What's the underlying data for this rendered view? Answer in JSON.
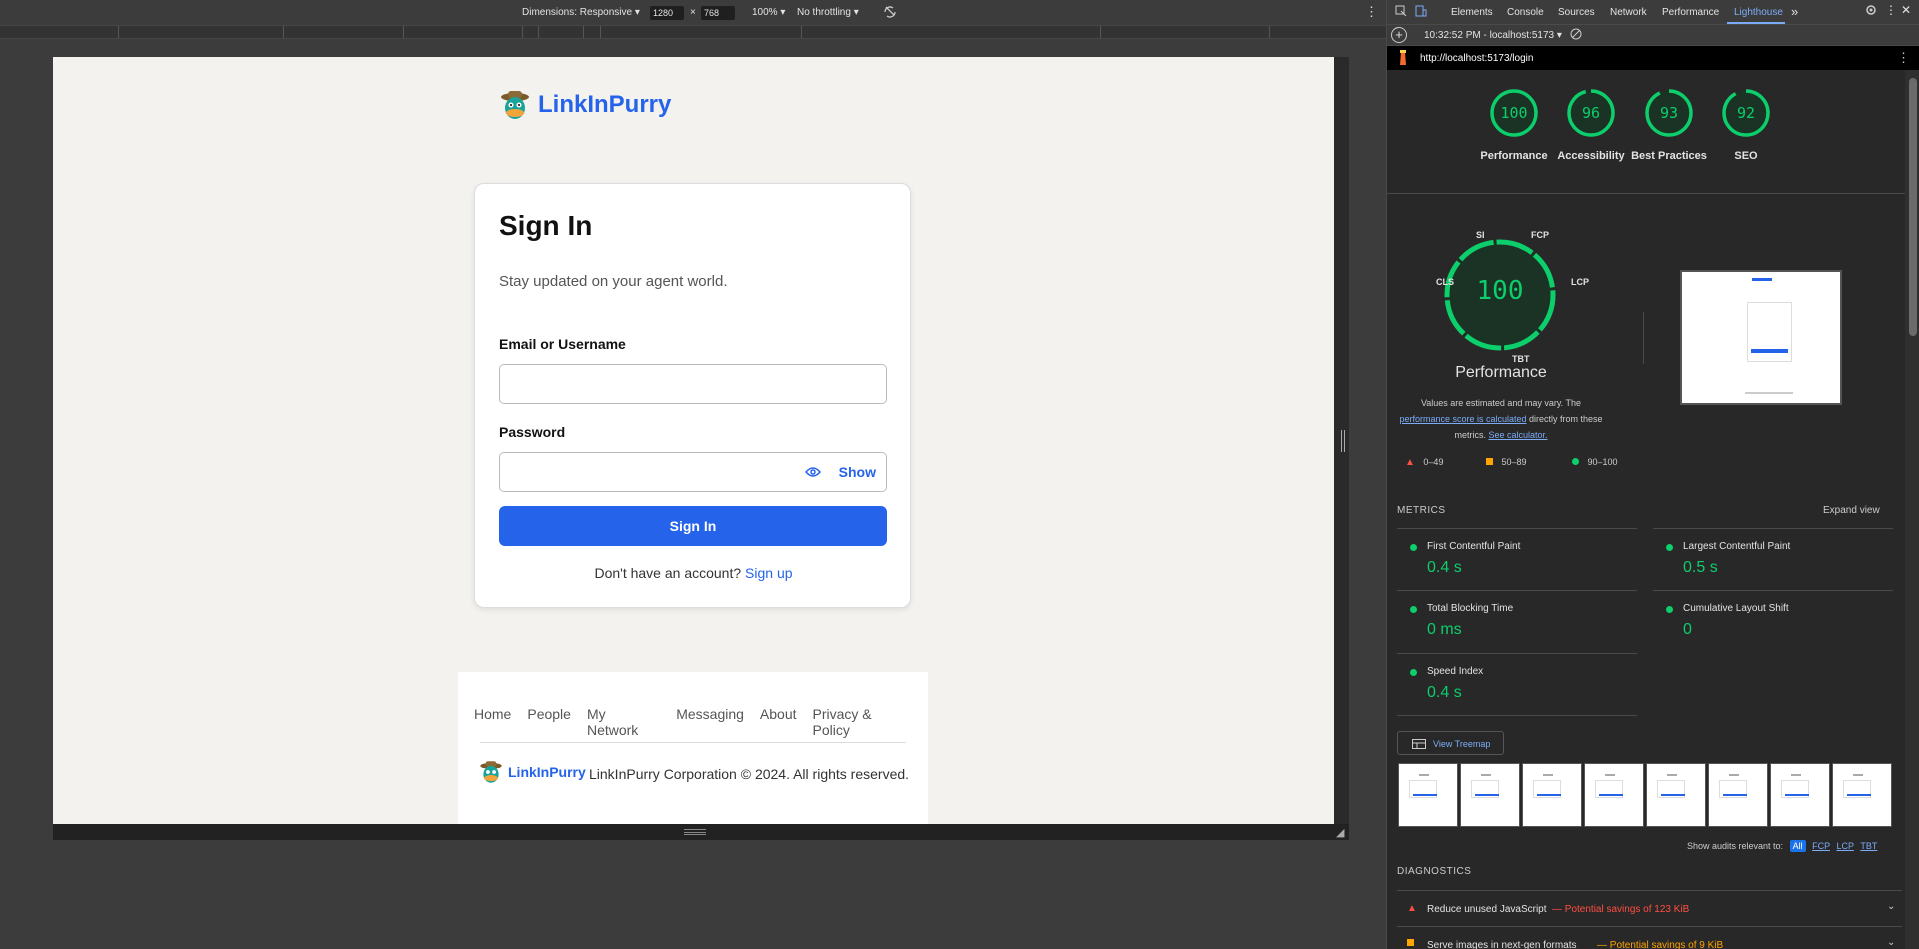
{
  "device_toolbar": {
    "dimensions_label": "Dimensions: Responsive ▾",
    "width": "1280",
    "x": "×",
    "height": "768",
    "zoom": "100% ▾",
    "throttling": "No throttling ▾"
  },
  "page": {
    "brand": "LinkInPurry",
    "title": "Sign In",
    "subtitle": "Stay updated on your agent world.",
    "email_label": "Email or Username",
    "password_label": "Password",
    "show_label": "Show",
    "signin_button": "Sign In",
    "no_account": "Don't have an account?",
    "signup_link": "Sign up",
    "footer_links": [
      "Home",
      "People",
      "My Network",
      "Messaging",
      "About",
      "Privacy & Policy"
    ],
    "copyright": "LinkInPurry Corporation © 2024. All rights reserved."
  },
  "devtools": {
    "tabs": [
      "Elements",
      "Console",
      "Sources",
      "Network",
      "Performance",
      "Lighthouse"
    ],
    "active_tab": "Lighthouse",
    "more": "»",
    "report_time": "10:32:52 PM - localhost:5173 ▾",
    "url": "http://localhost:5173/login",
    "scores": [
      {
        "value": "100",
        "label": "Performance",
        "fraction": 1.0
      },
      {
        "value": "96",
        "label": "Accessibility",
        "fraction": 0.96
      },
      {
        "value": "93",
        "label": "Best Practices",
        "fraction": 0.93
      },
      {
        "value": "92",
        "label": "SEO",
        "fraction": 0.92
      }
    ],
    "big_score": "100",
    "big_label": "Performance",
    "gauge_labels": {
      "si": "SI",
      "fcp": "FCP",
      "cls": "CLS",
      "lcp": "LCP",
      "tbt": "TBT"
    },
    "note_1": "Values are estimated and may vary. The",
    "note_link_1": "performance score is calculated",
    "note_2": "directly from these metrics.",
    "note_link_2": "See calculator.",
    "legend": [
      "0–49",
      "50–89",
      "90–100"
    ],
    "metrics_heading": "METRICS",
    "expand_view": "Expand view",
    "metrics": [
      {
        "name": "First Contentful Paint",
        "value": "0.4 s"
      },
      {
        "name": "Largest Contentful Paint",
        "value": "0.5 s"
      },
      {
        "name": "Total Blocking Time",
        "value": "0 ms"
      },
      {
        "name": "Cumulative Layout Shift",
        "value": "0"
      },
      {
        "name": "Speed Index",
        "value": "0.4 s"
      }
    ],
    "view_treemap": "View Treemap",
    "show_audits_label": "Show audits relevant to:",
    "audit_filters": [
      "All",
      "FCP",
      "LCP",
      "TBT"
    ],
    "diagnostics_heading": "DIAGNOSTICS",
    "diagnostics": [
      {
        "title": "Reduce unused JavaScript",
        "savings": "— Potential savings of 123 KiB",
        "color": "#ff4e42"
      },
      {
        "title": "Serve images in next-gen formats",
        "savings": "— Potential savings of 9 KiB",
        "color": "#ffa400"
      }
    ],
    "colors": {
      "pass": "#0cce6b",
      "average": "#ffa400",
      "fail": "#ff4e42",
      "link": "#7cacf8"
    }
  }
}
